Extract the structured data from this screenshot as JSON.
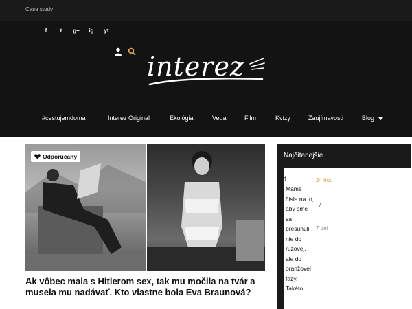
{
  "topbar": {
    "case_study": "Case study"
  },
  "social": [
    "f",
    "t",
    "g+",
    "ig",
    "yt"
  ],
  "social_icons": [
    "facebook-icon",
    "twitter-icon",
    "google-plus-icon",
    "instagram-icon",
    "youtube-icon"
  ],
  "logo": {
    "text": "interez"
  },
  "nav": {
    "items": [
      "#cestujemdoma",
      "Interez Original",
      "Ekológia",
      "Veda",
      "Film",
      "Kvízy",
      "Zaujímavosti",
      "Blog"
    ]
  },
  "article": {
    "badge": "Odporúčaný",
    "title": "Ak vôbec mala s Hitlerom sex, tak mu močila na tvár a musela mu nadávať. Kto vlastne bola Eva Braunová?"
  },
  "sidebar": {
    "heading": "Najčítanejšie",
    "number": "1.",
    "time_1": "24 hod",
    "slash": "/",
    "time_2": "7 dní",
    "tooltip": "Máme čísla na to, aby sme sa presunuli nie do ružovej, ale do oranžovej fázy. Takéto"
  },
  "colors": {
    "header_bg": "#141314",
    "accent": "#d8a24a",
    "text": "#111111"
  }
}
